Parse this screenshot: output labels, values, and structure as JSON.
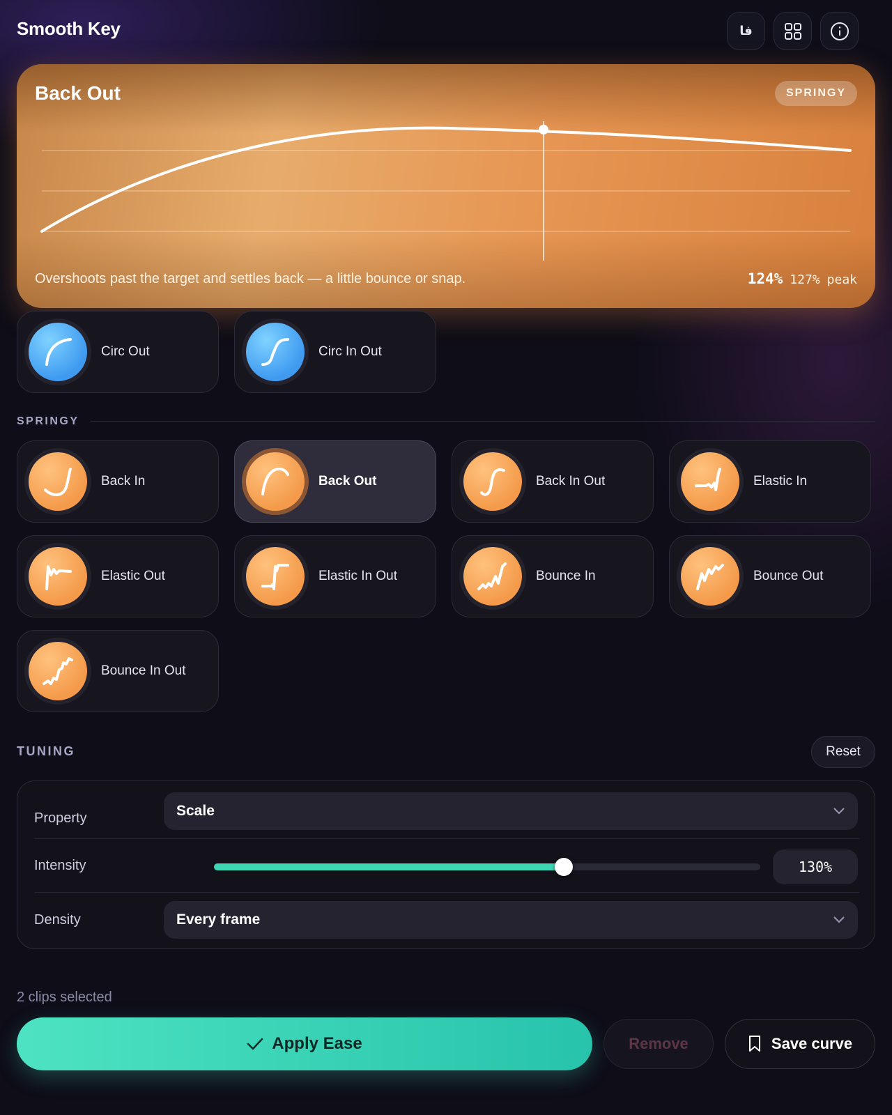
{
  "header": {
    "title": "Smooth Key",
    "buttons": [
      {
        "icon": "language-icon",
        "glyph": "فا"
      },
      {
        "icon": "grid-icon"
      },
      {
        "icon": "info-icon"
      }
    ]
  },
  "hero": {
    "title": "Back Out",
    "badge": "SPRINGY",
    "description": "Overshoots past the target and settles back — a little bounce or snap.",
    "current_value": "124%",
    "peak_value": "127%",
    "peak_label": "peak",
    "gradient_colors": [
      "#c8874a",
      "#e7ac6c",
      "#e79653",
      "#d8803d"
    ],
    "playhead_fraction": 0.62
  },
  "circ_presets": [
    {
      "label": "Circ Out",
      "icon": "circ-out-curve-icon",
      "color": "blue"
    },
    {
      "label": "Circ In Out",
      "icon": "circ-in-out-curve-icon",
      "color": "blue"
    }
  ],
  "springy_section": {
    "label": "SPRINGY",
    "presets": [
      {
        "label": "Back In",
        "icon": "back-in-curve-icon",
        "selected": false
      },
      {
        "label": "Back Out",
        "icon": "back-out-curve-icon",
        "selected": true
      },
      {
        "label": "Back In Out",
        "icon": "back-in-out-curve-icon",
        "selected": false
      },
      {
        "label": "Elastic In",
        "icon": "elastic-in-curve-icon",
        "selected": false
      },
      {
        "label": "Elastic Out",
        "icon": "elastic-out-curve-icon",
        "selected": false
      },
      {
        "label": "Elastic In Out",
        "icon": "elastic-in-out-curve-icon",
        "selected": false
      },
      {
        "label": "Bounce In",
        "icon": "bounce-in-curve-icon",
        "selected": false
      },
      {
        "label": "Bounce Out",
        "icon": "bounce-out-curve-icon",
        "selected": false
      },
      {
        "label": "Bounce In Out",
        "icon": "bounce-in-out-curve-icon",
        "selected": false
      }
    ]
  },
  "tuning": {
    "label": "TUNING",
    "reset_label": "Reset",
    "property_label": "Property",
    "property_value": "Scale",
    "intensity_label": "Intensity",
    "intensity_value": "130%",
    "intensity_fraction": 0.64,
    "density_label": "Density",
    "density_value": "Every frame"
  },
  "footer": {
    "selection_text": "2 clips selected",
    "apply_label": "Apply Ease",
    "remove_label": "Remove",
    "save_label": "Save curve"
  },
  "colors": {
    "accent": "#3ed7b5",
    "springy": "#f49a4a",
    "circ": "#3f9af0",
    "background": "#0e0d18"
  }
}
